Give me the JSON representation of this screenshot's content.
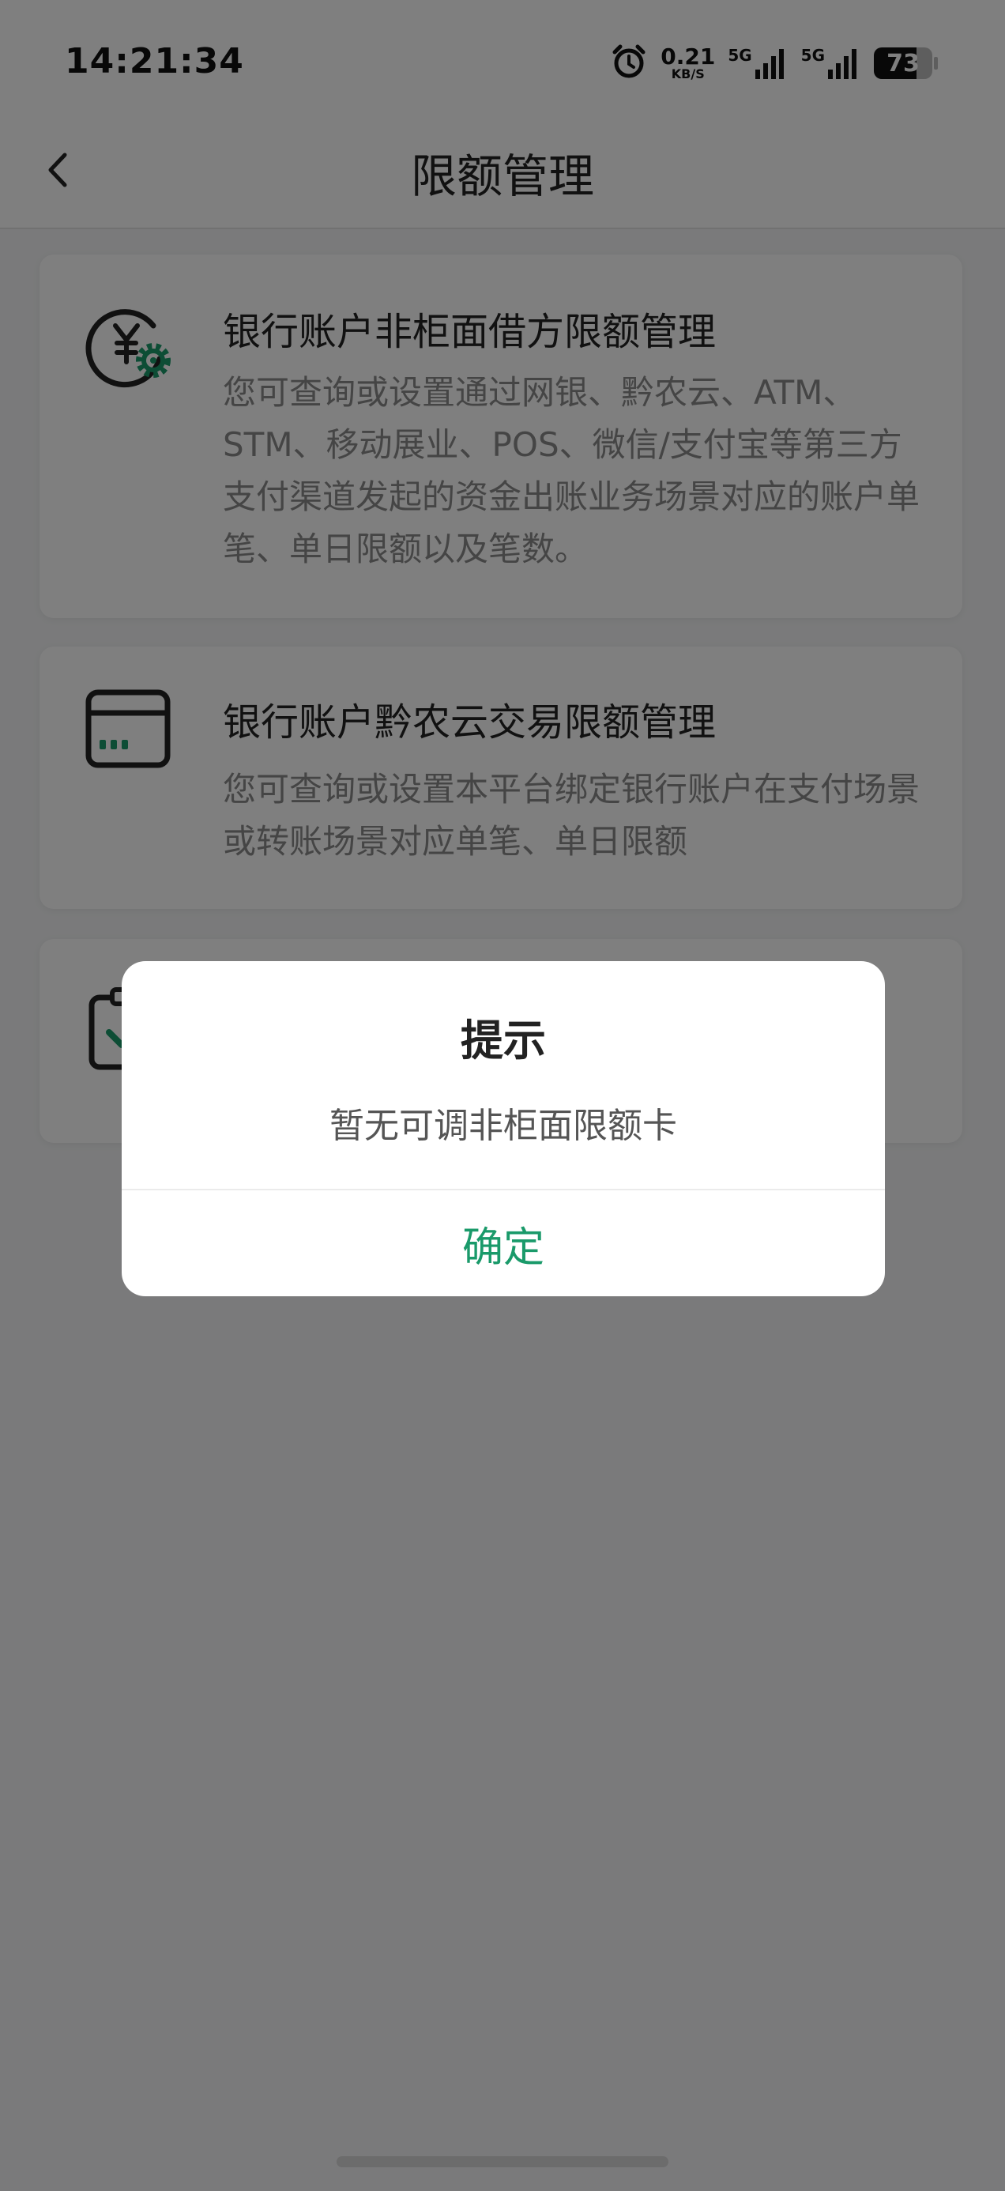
{
  "status_bar": {
    "time": "14:21:34",
    "net_speed_value": "0.21",
    "net_speed_unit": "KB/S",
    "sim1_label": "5G",
    "sim2_label": "5G",
    "battery_level": "73"
  },
  "nav": {
    "title": "限额管理",
    "back_icon": "chevron-left-icon"
  },
  "cards": [
    {
      "icon": "yuan-gear-icon",
      "title": "银行账户非柜面借方限额管理",
      "description": "您可查询或设置通过网银、黔农云、ATM、STM、移动展业、POS、微信/支付宝等第三方支付渠道发起的资金出账业务场景对应的账户单笔、单日限额以及笔数。"
    },
    {
      "icon": "card-icon",
      "title": "银行账户黔农云交易限额管理",
      "description": "您可查询或设置本平台绑定银行账户在支付场景或转账场景对应单笔、单日限额"
    },
    {
      "icon": "clipboard-check-icon",
      "title": "",
      "description": ""
    }
  ],
  "dialog": {
    "title": "提示",
    "message": "暂无可调非柜面限额卡",
    "confirm_label": "确定"
  },
  "colors": {
    "accent": "#1a9a6a",
    "overlay": "rgba(0,0,0,0.5)"
  }
}
